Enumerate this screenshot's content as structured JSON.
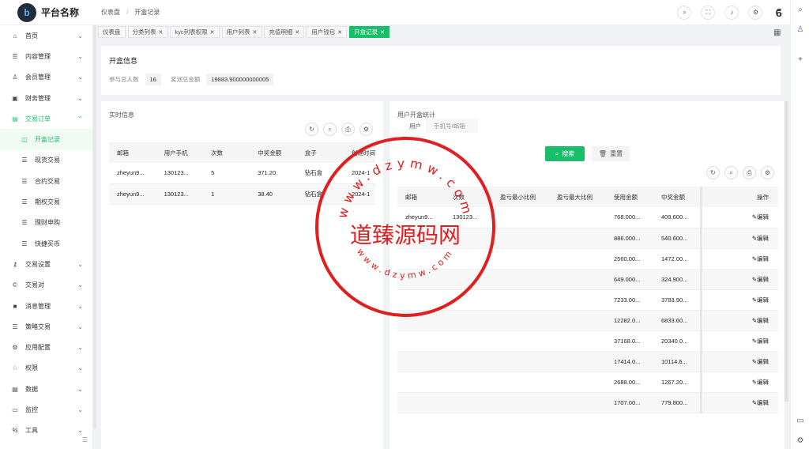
{
  "app": {
    "name": "平台名称"
  },
  "breadcrumb": [
    "仪表盘",
    "开盒记录"
  ],
  "sidebar": {
    "items": [
      {
        "label": "首页",
        "icon": "home-icon",
        "glyph": "⌂"
      },
      {
        "label": "内容管理",
        "icon": "list-icon",
        "glyph": "☰"
      },
      {
        "label": "会员管理",
        "icon": "user-icon",
        "glyph": "♙"
      },
      {
        "label": "财务管理",
        "icon": "finance-icon",
        "glyph": "▣"
      },
      {
        "label": "交易订单",
        "icon": "order-icon",
        "glyph": "▤"
      },
      {
        "label": "开盒记录",
        "icon": "record-icon",
        "glyph": "◫"
      },
      {
        "label": "现货交易",
        "icon": "list-icon",
        "glyph": "☰"
      },
      {
        "label": "合约交易",
        "icon": "list-icon",
        "glyph": "☰"
      },
      {
        "label": "期权交易",
        "icon": "list-icon",
        "glyph": "☰"
      },
      {
        "label": "理财申购",
        "icon": "list-icon",
        "glyph": "☰"
      },
      {
        "label": "快捷买币",
        "icon": "list-icon",
        "glyph": "☰"
      },
      {
        "label": "交易设置",
        "icon": "key-icon",
        "glyph": "⚷"
      },
      {
        "label": "交易对",
        "icon": "copyright-icon",
        "glyph": "©"
      },
      {
        "label": "消息管理",
        "icon": "message-icon",
        "glyph": "■"
      },
      {
        "label": "策略交易",
        "icon": "list-icon",
        "glyph": "☰"
      },
      {
        "label": "应用配置",
        "icon": "config-icon",
        "glyph": "⚙"
      },
      {
        "label": "权限",
        "icon": "permission-icon",
        "glyph": "♘"
      },
      {
        "label": "数据",
        "icon": "data-icon",
        "glyph": "▤"
      },
      {
        "label": "监控",
        "icon": "monitor-icon",
        "glyph": "▭"
      },
      {
        "label": "工具",
        "icon": "tool-icon",
        "glyph": "%"
      }
    ]
  },
  "tabs": [
    {
      "label": "仪表盘",
      "closable": false
    },
    {
      "label": "分类列表",
      "closable": true
    },
    {
      "label": "kyc列表权限",
      "closable": true
    },
    {
      "label": "用户列表",
      "closable": true
    },
    {
      "label": "充值明细",
      "closable": true
    },
    {
      "label": "用户钱包",
      "closable": true
    },
    {
      "label": "开盒记录",
      "closable": true,
      "active": true
    }
  ],
  "info": {
    "title": "开盒信息",
    "participants_label": "参与总人数",
    "participants_value": "16",
    "pool_label": "奖池总金额",
    "pool_value": "19883.900000000005"
  },
  "realtime": {
    "title": "实时信息",
    "columns": [
      "邮箱",
      "用户手机",
      "次数",
      "中奖金额",
      "盒子",
      "创建时间"
    ],
    "rows": [
      [
        "zheyun9...",
        "130123...",
        "5",
        "371.20",
        "钻石盒",
        "2024-1"
      ],
      [
        "zheyun9...",
        "130123...",
        "1",
        "38.40",
        "钻石盒",
        "2024-1"
      ]
    ]
  },
  "stats": {
    "title": "用户开盒统计",
    "filter_tab": "用户",
    "filter_placeholder": "手机号/邮箱",
    "search_label": "搜索",
    "reset_label": "重置",
    "columns": [
      "邮箱",
      "次数",
      "盈亏最小比例",
      "盈亏最大比例",
      "使用金额",
      "中奖金额",
      "操作"
    ],
    "edit_label": "编辑",
    "rows": [
      [
        "zheyun9...",
        "130123...",
        "",
        "",
        "768.000...",
        "409.600..."
      ],
      [
        "",
        "",
        "",
        "",
        "886.000...",
        "540.600..."
      ],
      [
        "",
        "",
        "",
        "",
        "2560.00...",
        "1472.00..."
      ],
      [
        "",
        "",
        "",
        "",
        "649.000...",
        "324.900..."
      ],
      [
        "",
        "",
        "",
        "",
        "7233.00...",
        "3783.90..."
      ],
      [
        "",
        "",
        "",
        "",
        "12282.0...",
        "6833.60..."
      ],
      [
        "",
        "",
        "",
        "",
        "37168.0...",
        "20340.0..."
      ],
      [
        "",
        "",
        "",
        "",
        "17414.0...",
        "10114.6..."
      ],
      [
        "",
        "",
        "",
        "",
        "2688.00...",
        "1267.20..."
      ],
      [
        "",
        "",
        "",
        "",
        "1707.00...",
        "779.800..."
      ]
    ]
  },
  "watermark": {
    "center_text": "道臻源码网",
    "ring_text": "www.dzymw.com",
    "color": "#e02020"
  },
  "colors": {
    "accent": "#19be6b"
  }
}
